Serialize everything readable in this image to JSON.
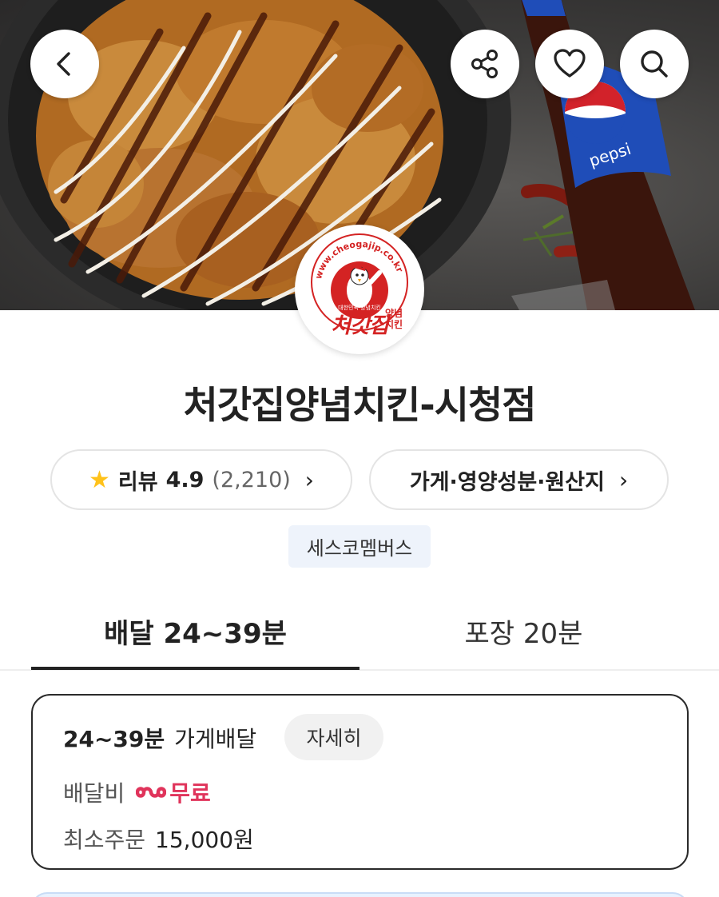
{
  "hero": {
    "bottle_brand": "pepsi",
    "buttons": {
      "back": "back",
      "share": "share",
      "favorite": "favorite",
      "search": "search"
    }
  },
  "logo": {
    "url_text": "www.cheogajip.co.kr",
    "mark_text": "처갓집",
    "sub_text": "양념치킨",
    "tagline": "대한민국 양념치킨"
  },
  "store": {
    "title": "처갓집양념치킨-시청점"
  },
  "review_pill": {
    "label": "리뷰",
    "rating": "4.9",
    "count": "(2,210)",
    "chevron": "›"
  },
  "info_pill": {
    "label": "가게·영양성분·원산지",
    "chevron": "›"
  },
  "tag": {
    "label": "세스코멤버스"
  },
  "tabs": [
    {
      "label": "배달 24~39분",
      "active": true
    },
    {
      "label": "포장 20분",
      "active": false
    }
  ],
  "delivery": {
    "time": "24~39분",
    "type": "가게배달",
    "detail_button": "자세히",
    "fee_label": "배달비",
    "fee_value": "무료",
    "min_order_label": "최소주문",
    "min_order_value": "15,000원"
  },
  "colors": {
    "accent_red": "#e0345b",
    "star": "#ffc21a",
    "tag_bg": "#eef3fb"
  }
}
